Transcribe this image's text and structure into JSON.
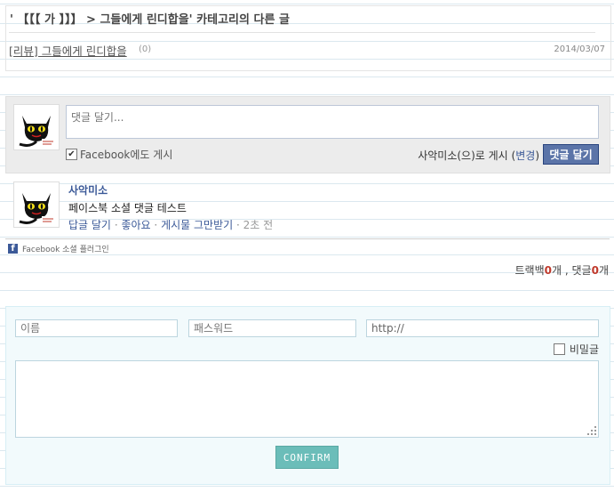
{
  "related": {
    "title": "' 【【【 가 】】】 > 그들에게 린디합을' 카테고리의 다른 글",
    "post_title": "[리뷰] 그들에게 린디합을",
    "post_comment_count": "(0)",
    "post_date": "2014/03/07"
  },
  "facebook": {
    "placeholder": "댓글 달기...",
    "post_to_facebook": "Facebook에도 게시",
    "post_as_prefix": "사악미소(으)로 게시 (",
    "change_label": "변경",
    "post_as_suffix": ")",
    "submit_label": "댓글 달기",
    "plugin_label": "Facebook 소셜 플러그인"
  },
  "comment": {
    "author": "사악미소",
    "text": "페이스북 소셜 댓글 테스트",
    "reply": "답글 달기",
    "like": "좋아요",
    "unfollow": "게시물 그만받기",
    "time": "2초 전",
    "separator": "·"
  },
  "trackback": {
    "trackback_label": "트랙백",
    "trackback_count": "0",
    "count_unit": "개",
    "sep": " , ",
    "comment_label": "댓글",
    "comment_count": "0"
  },
  "guestbook": {
    "name_placeholder": "이름",
    "password_placeholder": "패스워드",
    "url_value": "http://",
    "secret_label": "비밀글",
    "confirm_label": "CONFIRM"
  },
  "colors": {
    "facebook_blue": "#3b5998",
    "button_blue": "#5b74a8",
    "confirm_teal": "#6bbdb9",
    "count_red": "#c0392b"
  }
}
